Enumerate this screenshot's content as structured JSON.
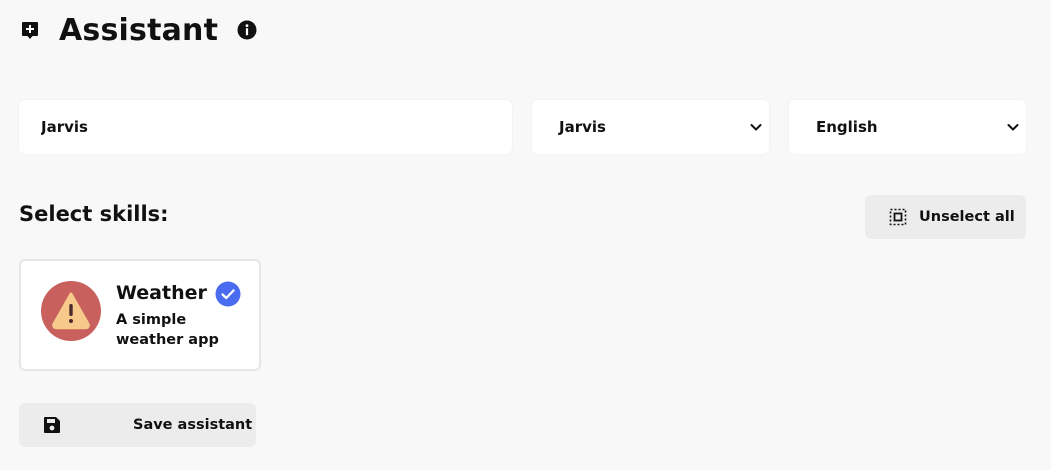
{
  "header": {
    "title": "Assistant",
    "app_icon": "assistant-plus-icon",
    "info_icon": "info-icon"
  },
  "form": {
    "name_value": "Jarvis",
    "voice_selected": "Jarvis",
    "language_selected": "English"
  },
  "skills": {
    "title": "Select skills:",
    "unselect_all_label": "Unselect all",
    "items": [
      {
        "name": "Weather",
        "description": "A simple weather app",
        "icon": "warning-icon",
        "selected": true
      }
    ]
  },
  "actions": {
    "save_label": "Save assistant",
    "save_icon": "floppy-disk-icon"
  },
  "colors": {
    "background": "#f8f8f8",
    "accent": "#4a6cf0",
    "avatar_bg": "#c8605e",
    "warning_fill": "#f7c98b"
  }
}
